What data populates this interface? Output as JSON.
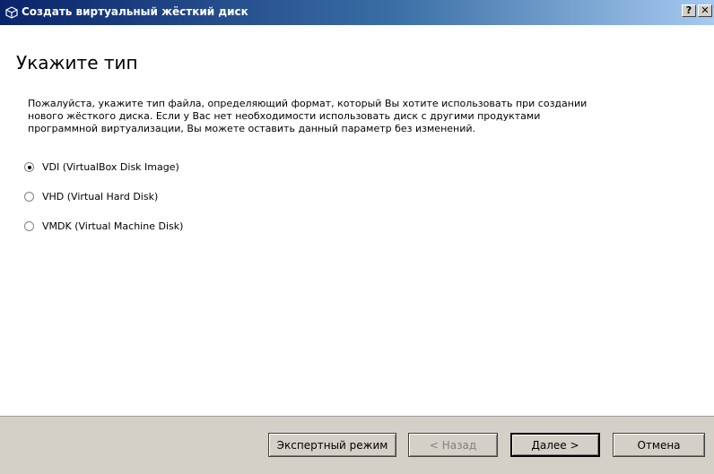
{
  "window": {
    "title": "Создать виртуальный жёсткий диск",
    "help_label": "?",
    "close_label": "✕"
  },
  "page": {
    "heading": "Укажите тип",
    "description_lines": [
      "Пожалуйста, укажите тип файла, определяющий формат, который Вы хотите использовать при создании",
      "нового жёсткого диска. Если у Вас нет необходимости использовать диск с другими продуктами",
      "программной виртуализации, Вы можете оставить данный параметр без изменений."
    ],
    "options": [
      {
        "label": "VDI (VirtualBox Disk Image)",
        "selected": true
      },
      {
        "label": "VHD (Virtual Hard Disk)",
        "selected": false
      },
      {
        "label": "VMDK (Virtual Machine Disk)",
        "selected": false
      }
    ]
  },
  "buttons": {
    "expert": "Экспертный режим",
    "back": "< Назад",
    "next": "Далее >",
    "cancel": "Отмена"
  }
}
